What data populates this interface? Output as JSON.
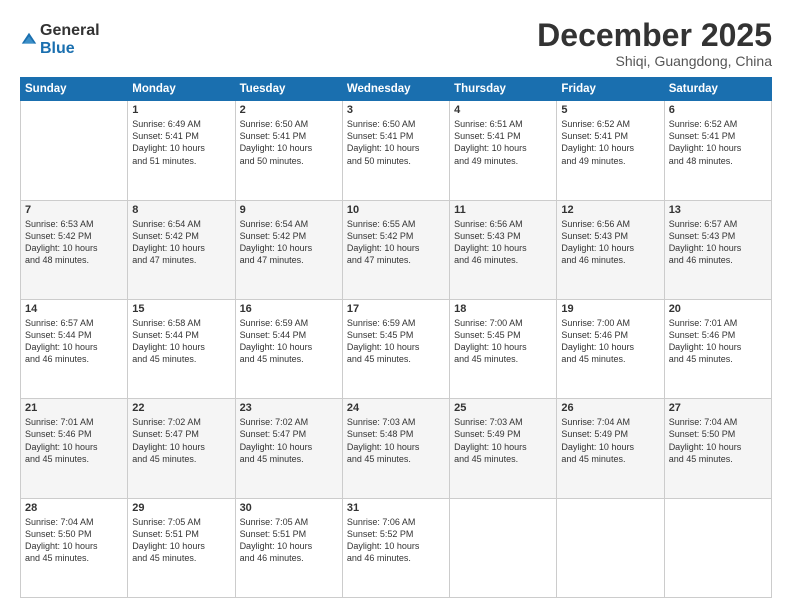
{
  "logo": {
    "general": "General",
    "blue": "Blue"
  },
  "title": "December 2025",
  "subtitle": "Shiqi, Guangdong, China",
  "days_header": [
    "Sunday",
    "Monday",
    "Tuesday",
    "Wednesday",
    "Thursday",
    "Friday",
    "Saturday"
  ],
  "weeks": [
    [
      {
        "day": "",
        "info": ""
      },
      {
        "day": "1",
        "info": "Sunrise: 6:49 AM\nSunset: 5:41 PM\nDaylight: 10 hours\nand 51 minutes."
      },
      {
        "day": "2",
        "info": "Sunrise: 6:50 AM\nSunset: 5:41 PM\nDaylight: 10 hours\nand 50 minutes."
      },
      {
        "day": "3",
        "info": "Sunrise: 6:50 AM\nSunset: 5:41 PM\nDaylight: 10 hours\nand 50 minutes."
      },
      {
        "day": "4",
        "info": "Sunrise: 6:51 AM\nSunset: 5:41 PM\nDaylight: 10 hours\nand 49 minutes."
      },
      {
        "day": "5",
        "info": "Sunrise: 6:52 AM\nSunset: 5:41 PM\nDaylight: 10 hours\nand 49 minutes."
      },
      {
        "day": "6",
        "info": "Sunrise: 6:52 AM\nSunset: 5:41 PM\nDaylight: 10 hours\nand 48 minutes."
      }
    ],
    [
      {
        "day": "7",
        "info": "Sunrise: 6:53 AM\nSunset: 5:42 PM\nDaylight: 10 hours\nand 48 minutes."
      },
      {
        "day": "8",
        "info": "Sunrise: 6:54 AM\nSunset: 5:42 PM\nDaylight: 10 hours\nand 47 minutes."
      },
      {
        "day": "9",
        "info": "Sunrise: 6:54 AM\nSunset: 5:42 PM\nDaylight: 10 hours\nand 47 minutes."
      },
      {
        "day": "10",
        "info": "Sunrise: 6:55 AM\nSunset: 5:42 PM\nDaylight: 10 hours\nand 47 minutes."
      },
      {
        "day": "11",
        "info": "Sunrise: 6:56 AM\nSunset: 5:43 PM\nDaylight: 10 hours\nand 46 minutes."
      },
      {
        "day": "12",
        "info": "Sunrise: 6:56 AM\nSunset: 5:43 PM\nDaylight: 10 hours\nand 46 minutes."
      },
      {
        "day": "13",
        "info": "Sunrise: 6:57 AM\nSunset: 5:43 PM\nDaylight: 10 hours\nand 46 minutes."
      }
    ],
    [
      {
        "day": "14",
        "info": "Sunrise: 6:57 AM\nSunset: 5:44 PM\nDaylight: 10 hours\nand 46 minutes."
      },
      {
        "day": "15",
        "info": "Sunrise: 6:58 AM\nSunset: 5:44 PM\nDaylight: 10 hours\nand 45 minutes."
      },
      {
        "day": "16",
        "info": "Sunrise: 6:59 AM\nSunset: 5:44 PM\nDaylight: 10 hours\nand 45 minutes."
      },
      {
        "day": "17",
        "info": "Sunrise: 6:59 AM\nSunset: 5:45 PM\nDaylight: 10 hours\nand 45 minutes."
      },
      {
        "day": "18",
        "info": "Sunrise: 7:00 AM\nSunset: 5:45 PM\nDaylight: 10 hours\nand 45 minutes."
      },
      {
        "day": "19",
        "info": "Sunrise: 7:00 AM\nSunset: 5:46 PM\nDaylight: 10 hours\nand 45 minutes."
      },
      {
        "day": "20",
        "info": "Sunrise: 7:01 AM\nSunset: 5:46 PM\nDaylight: 10 hours\nand 45 minutes."
      }
    ],
    [
      {
        "day": "21",
        "info": "Sunrise: 7:01 AM\nSunset: 5:46 PM\nDaylight: 10 hours\nand 45 minutes."
      },
      {
        "day": "22",
        "info": "Sunrise: 7:02 AM\nSunset: 5:47 PM\nDaylight: 10 hours\nand 45 minutes."
      },
      {
        "day": "23",
        "info": "Sunrise: 7:02 AM\nSunset: 5:47 PM\nDaylight: 10 hours\nand 45 minutes."
      },
      {
        "day": "24",
        "info": "Sunrise: 7:03 AM\nSunset: 5:48 PM\nDaylight: 10 hours\nand 45 minutes."
      },
      {
        "day": "25",
        "info": "Sunrise: 7:03 AM\nSunset: 5:49 PM\nDaylight: 10 hours\nand 45 minutes."
      },
      {
        "day": "26",
        "info": "Sunrise: 7:04 AM\nSunset: 5:49 PM\nDaylight: 10 hours\nand 45 minutes."
      },
      {
        "day": "27",
        "info": "Sunrise: 7:04 AM\nSunset: 5:50 PM\nDaylight: 10 hours\nand 45 minutes."
      }
    ],
    [
      {
        "day": "28",
        "info": "Sunrise: 7:04 AM\nSunset: 5:50 PM\nDaylight: 10 hours\nand 45 minutes."
      },
      {
        "day": "29",
        "info": "Sunrise: 7:05 AM\nSunset: 5:51 PM\nDaylight: 10 hours\nand 45 minutes."
      },
      {
        "day": "30",
        "info": "Sunrise: 7:05 AM\nSunset: 5:51 PM\nDaylight: 10 hours\nand 46 minutes."
      },
      {
        "day": "31",
        "info": "Sunrise: 7:06 AM\nSunset: 5:52 PM\nDaylight: 10 hours\nand 46 minutes."
      },
      {
        "day": "",
        "info": ""
      },
      {
        "day": "",
        "info": ""
      },
      {
        "day": "",
        "info": ""
      }
    ]
  ]
}
